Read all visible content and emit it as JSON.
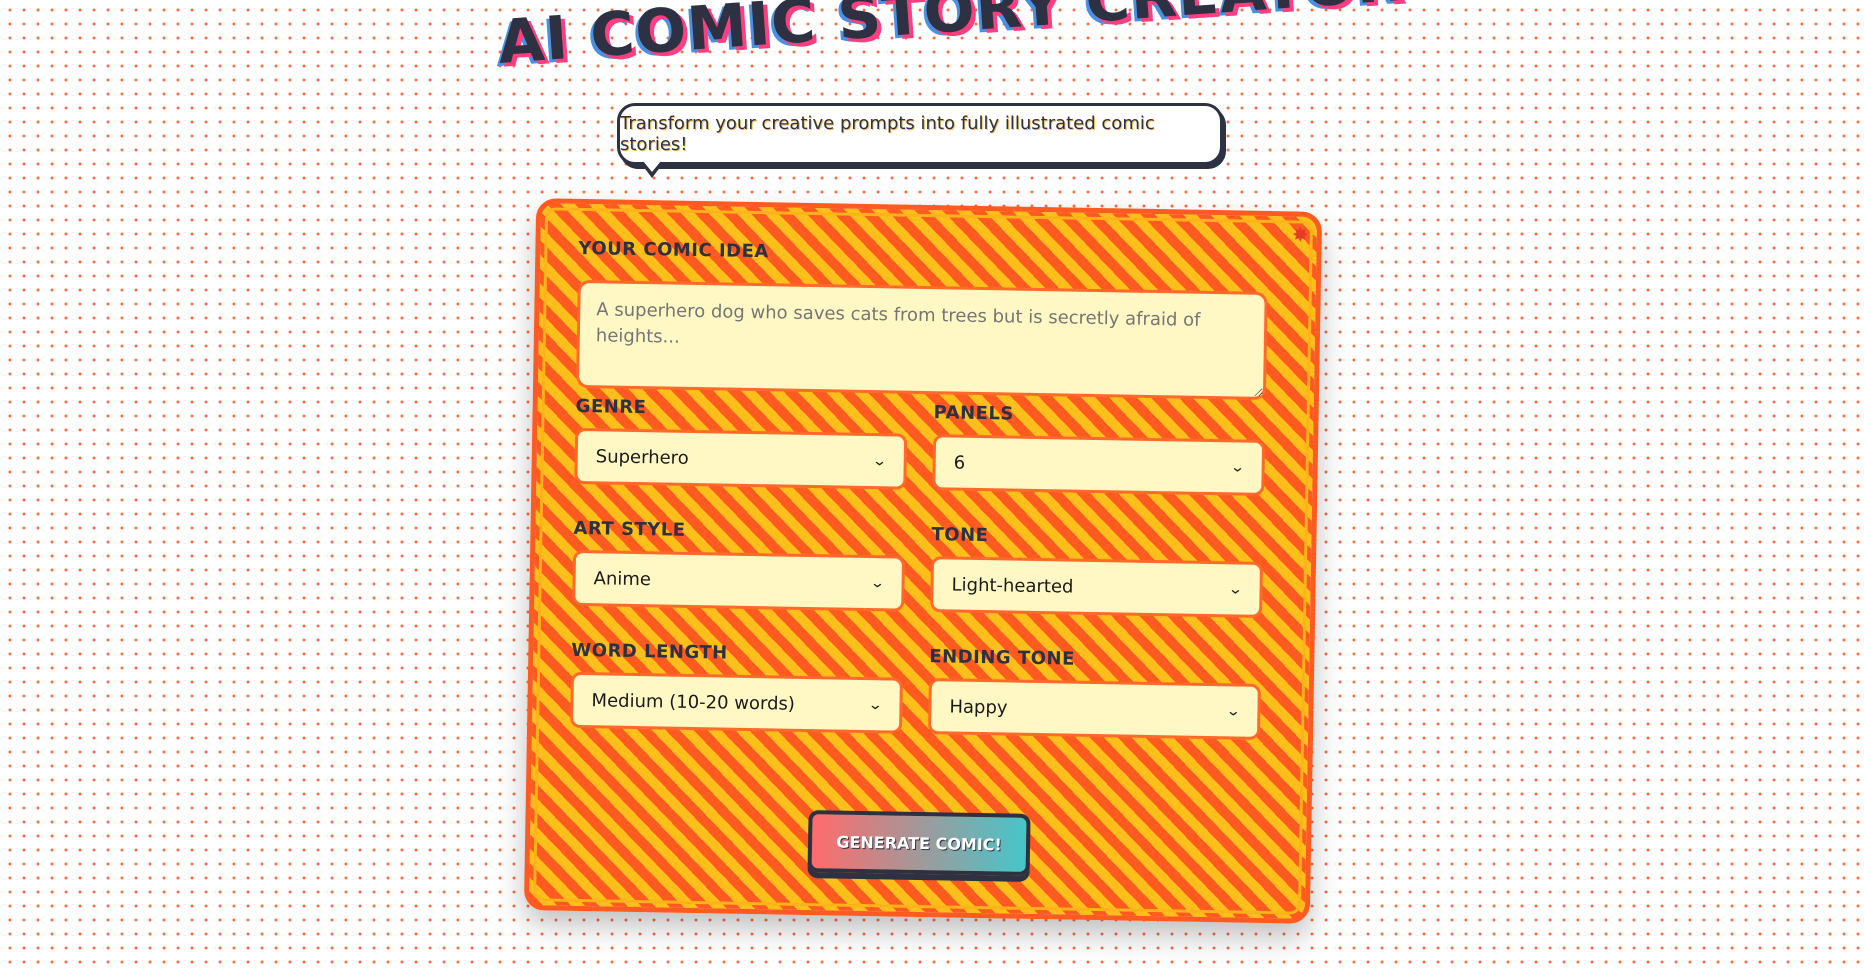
{
  "header": {
    "title": "AI COMIC STORY CREATOR",
    "subtitle": "Transform your creative prompts into fully illustrated comic stories!"
  },
  "form": {
    "idea": {
      "label": "Your Comic Idea",
      "placeholder": "A superhero dog who saves cats from trees but is secretly afraid of heights...",
      "value": ""
    },
    "genre": {
      "label": "Genre",
      "value": "Superhero"
    },
    "panels": {
      "label": "Panels",
      "value": "6"
    },
    "art_style": {
      "label": "Art Style",
      "value": "Anime"
    },
    "tone": {
      "label": "Tone",
      "value": "Light-hearted"
    },
    "word_length": {
      "label": "Word Length",
      "value": "Medium (10-20 words)"
    },
    "ending_tone": {
      "label": "Ending Tone",
      "value": "Happy"
    },
    "generate_label": "Generate Comic!"
  },
  "icons": {
    "select_chevron": "chevron-down-icon",
    "corner_decoration": "star-icon"
  },
  "colors": {
    "dots": "#ff6a3d",
    "stripe_orange": "#ff5a1f",
    "stripe_yellow": "#ffbf1a",
    "field_bg": "#fff8c4",
    "title_dark": "#2d3142",
    "title_pink": "#ff3d7f",
    "title_blue": "#4a90e2",
    "button_start": "#ff6b6b",
    "button_end": "#45c6c9"
  }
}
